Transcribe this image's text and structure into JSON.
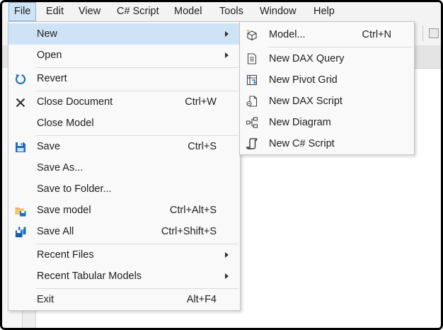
{
  "menubar": {
    "items": [
      "File",
      "Edit",
      "View",
      "C# Script",
      "Model",
      "Tools",
      "Window",
      "Help"
    ]
  },
  "file_menu": {
    "new": {
      "label": "New"
    },
    "open": {
      "label": "Open"
    },
    "revert": {
      "label": "Revert",
      "icon": "revert-icon"
    },
    "close_document": {
      "label": "Close Document",
      "shortcut": "Ctrl+W",
      "icon": "close-icon"
    },
    "close_model": {
      "label": "Close Model"
    },
    "save": {
      "label": "Save",
      "shortcut": "Ctrl+S",
      "icon": "save-icon"
    },
    "save_as": {
      "label": "Save As..."
    },
    "save_to_folder": {
      "label": "Save to Folder..."
    },
    "save_model": {
      "label": "Save model",
      "shortcut": "Ctrl+Alt+S",
      "icon": "save-model-icon"
    },
    "save_all": {
      "label": "Save All",
      "shortcut": "Ctrl+Shift+S",
      "icon": "save-all-icon"
    },
    "recent_files": {
      "label": "Recent Files"
    },
    "recent_tabular_models": {
      "label": "Recent Tabular Models"
    },
    "exit": {
      "label": "Exit",
      "shortcut": "Alt+F4"
    }
  },
  "new_submenu": {
    "model": {
      "label": "Model...",
      "shortcut": "Ctrl+N",
      "icon": "new-model-icon"
    },
    "dax_query": {
      "label": "New DAX Query",
      "icon": "dax-query-icon"
    },
    "pivot_grid": {
      "label": "New Pivot Grid",
      "icon": "pivot-grid-icon"
    },
    "dax_script": {
      "label": "New DAX Script",
      "icon": "dax-script-icon"
    },
    "diagram": {
      "label": "New Diagram",
      "icon": "diagram-icon"
    },
    "csharp_script": {
      "label": "New C# Script",
      "icon": "csharp-script-icon"
    }
  },
  "colors": {
    "highlight": "#cfe3f7",
    "menu_bg": "#f9f9f9",
    "accent_blue": "#1a6fc4"
  }
}
